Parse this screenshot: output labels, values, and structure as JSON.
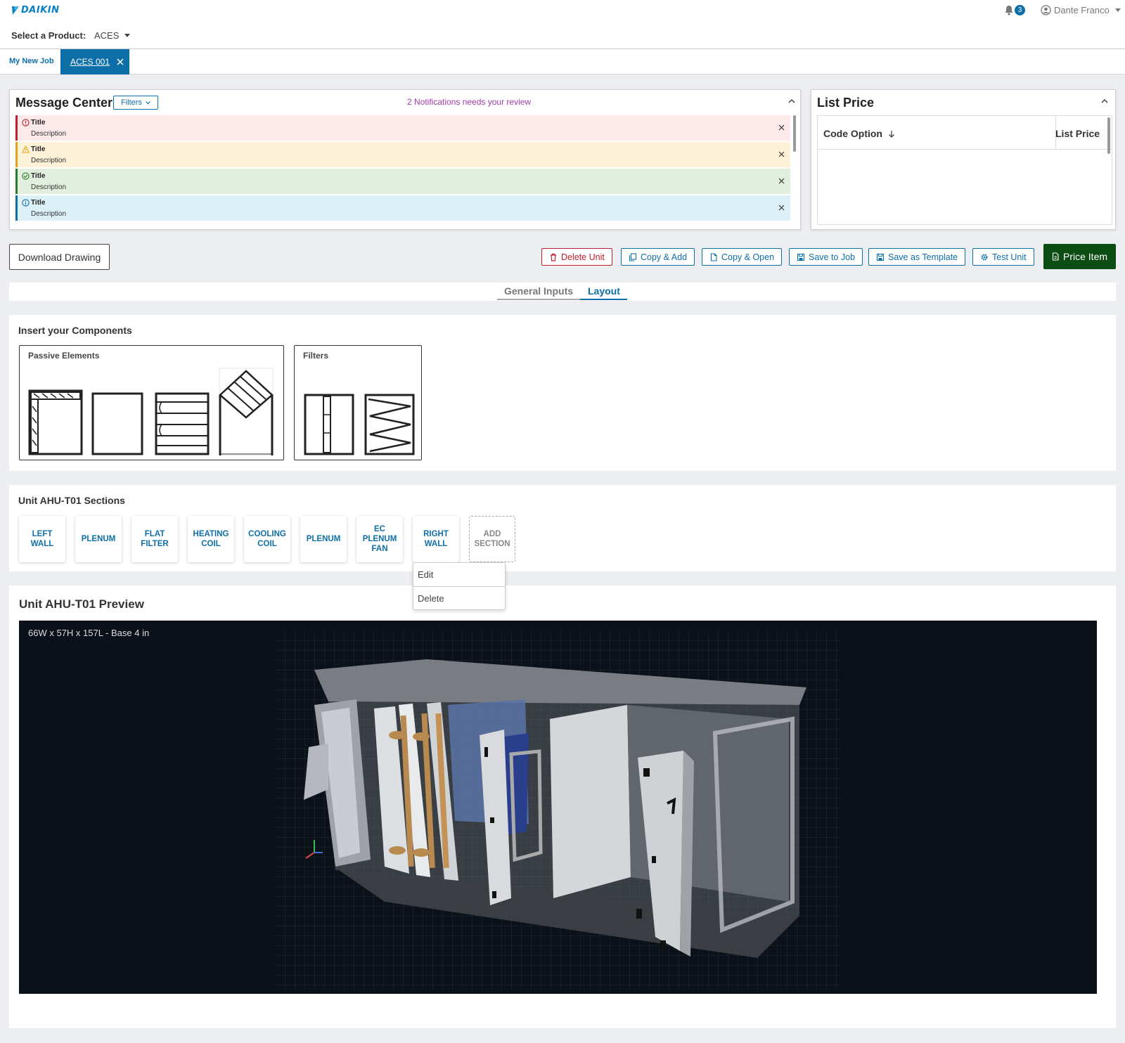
{
  "header": {
    "logo_text": "DAIKIN",
    "notification_count": "3",
    "user_name": "Dante Franco"
  },
  "product": {
    "label": "Select a Product:",
    "value": "ACES"
  },
  "tabs": {
    "job": "My New Job",
    "active": "ACES 001"
  },
  "message_center": {
    "title": "Message Center",
    "filters_label": "Filters",
    "notice": "2 Notifications needs your review",
    "messages": [
      {
        "type": "error",
        "title": "Title",
        "description": "Description",
        "bg": "#fde9ea",
        "border": "#c21f2a"
      },
      {
        "type": "warning",
        "title": "Title",
        "description": "Description",
        "bg": "#fdf1d8",
        "border": "#e5a31b"
      },
      {
        "type": "success",
        "title": "Title",
        "description": "Description",
        "bg": "#e2efde",
        "border": "#2d7a2a"
      },
      {
        "type": "info",
        "title": "Title",
        "description": "Description",
        "bg": "#dcf0f8",
        "border": "#0d6fa8"
      }
    ]
  },
  "list_price": {
    "title": "List Price",
    "col_code": "Code Option",
    "col_price": "List Price"
  },
  "actions": {
    "download": "Download Drawing",
    "delete_unit": "Delete Unit",
    "copy_add": "Copy & Add",
    "copy_open": "Copy & Open",
    "save_job": "Save to Job",
    "save_template": "Save as Template",
    "test_unit": "Test Unit",
    "price_item": "Price Item"
  },
  "view_tabs": {
    "general": "General Inputs",
    "layout": "Layout"
  },
  "components": {
    "title": "Insert your Components",
    "passive_title": "Passive Elements",
    "filters_title": "Filters"
  },
  "sections": {
    "title": "Unit AHU-T01 Sections",
    "items": [
      "LEFT WALL",
      "PLENUM",
      "FLAT FILTER",
      "HEATING COIL",
      "COOLING COIL",
      "PLENUM",
      "EC PLENUM FAN",
      "RIGHT WALL"
    ],
    "add_label": "ADD SECTION"
  },
  "context_menu": {
    "edit": "Edit",
    "delete": "Delete"
  },
  "preview": {
    "title": "Unit AHU-T01 Preview",
    "dimensions": "66W x 57H x 157L - Base 4 in"
  },
  "colors": {
    "primary": "#0d6fa8",
    "danger": "#c21f2a",
    "price_button": "#0b4d12",
    "notice": "#a23aa8"
  }
}
